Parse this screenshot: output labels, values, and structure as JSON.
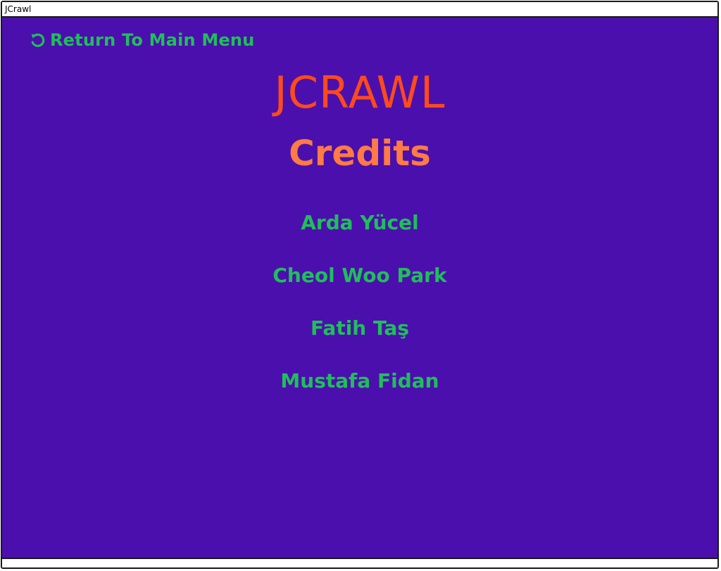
{
  "window": {
    "title": "JCrawl"
  },
  "nav": {
    "back_label": "Return To Main Menu",
    "back_icon": "rotate-left-icon"
  },
  "header": {
    "app_title": "JCRAWL",
    "section_title": "Credits"
  },
  "credits": [
    "Arda Yücel",
    "Cheol Woo Park",
    "Fatih Taş",
    "Mustafa Fidan"
  ],
  "colors": {
    "background": "#4b0fae",
    "accent_green": "#1fbf5a",
    "title_orange": "#ff4a1c",
    "section_orange": "#ff7a45"
  }
}
